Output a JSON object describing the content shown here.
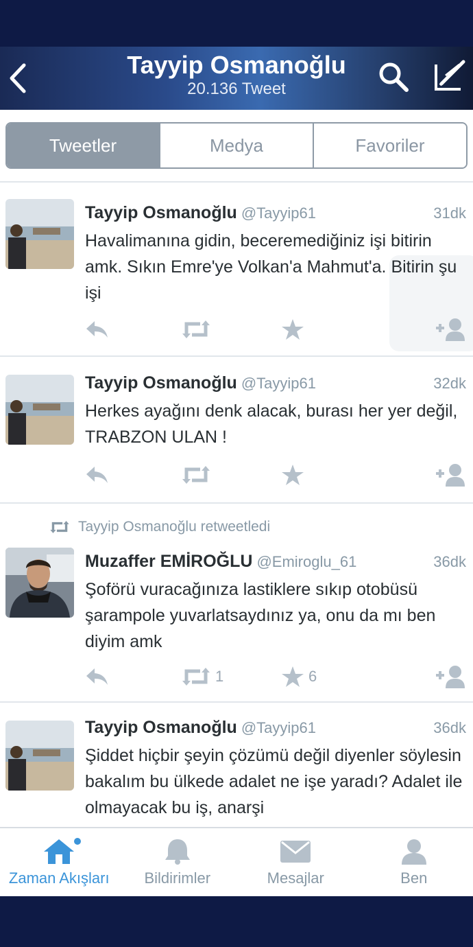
{
  "header": {
    "title": "Tayyip Osmanoğlu",
    "subtitle": "20.136 Tweet"
  },
  "segments": [
    "Tweetler",
    "Medya",
    "Favoriler"
  ],
  "tweets": [
    {
      "name": "Tayyip Osmanoğlu",
      "handle": "@Tayyip61",
      "time": "31dk",
      "text": "Havalimanına gidin, beceremediğiniz işi bitirin amk. Sıkın Emre'ye Volkan'a Mahmut'a. Bitirin şu işi"
    },
    {
      "name": "Tayyip Osmanoğlu",
      "handle": "@Tayyip61",
      "time": "32dk",
      "text": "Herkes ayağını denk alacak, burası her yer değil, TRABZON ULAN !"
    },
    {
      "retweeted_by": "Tayyip Osmanoğlu retweetledi",
      "name": "Muzaffer EMİROĞLU",
      "handle": "@Emiroglu_61",
      "time": "36dk",
      "text": "Şoförü vuracağınıza lastiklere sıkıp otobüsü şarampole yuvarlatsaydınız ya, onu da mı ben diyim amk",
      "retweets": "1",
      "favorites": "6"
    },
    {
      "name": "Tayyip Osmanoğlu",
      "handle": "@Tayyip61",
      "time": "36dk",
      "text": "Şiddet hiçbir şeyin çözümü değil diyenler söylesin bakalım bu ülkede adalet ne işe yaradı? Adalet ile olmayacak bu iş, anarşi"
    }
  ],
  "tabbar": [
    {
      "label": "Zaman Akışları",
      "icon": "home-icon"
    },
    {
      "label": "Bildirimler",
      "icon": "bell-icon"
    },
    {
      "label": "Mesajlar",
      "icon": "envelope-icon"
    },
    {
      "label": "Ben",
      "icon": "person-icon"
    }
  ],
  "colors": {
    "accent": "#3b94d9",
    "muted": "#8899a6",
    "segment_active": "#8e9aa6",
    "band": "#0e1a45"
  }
}
